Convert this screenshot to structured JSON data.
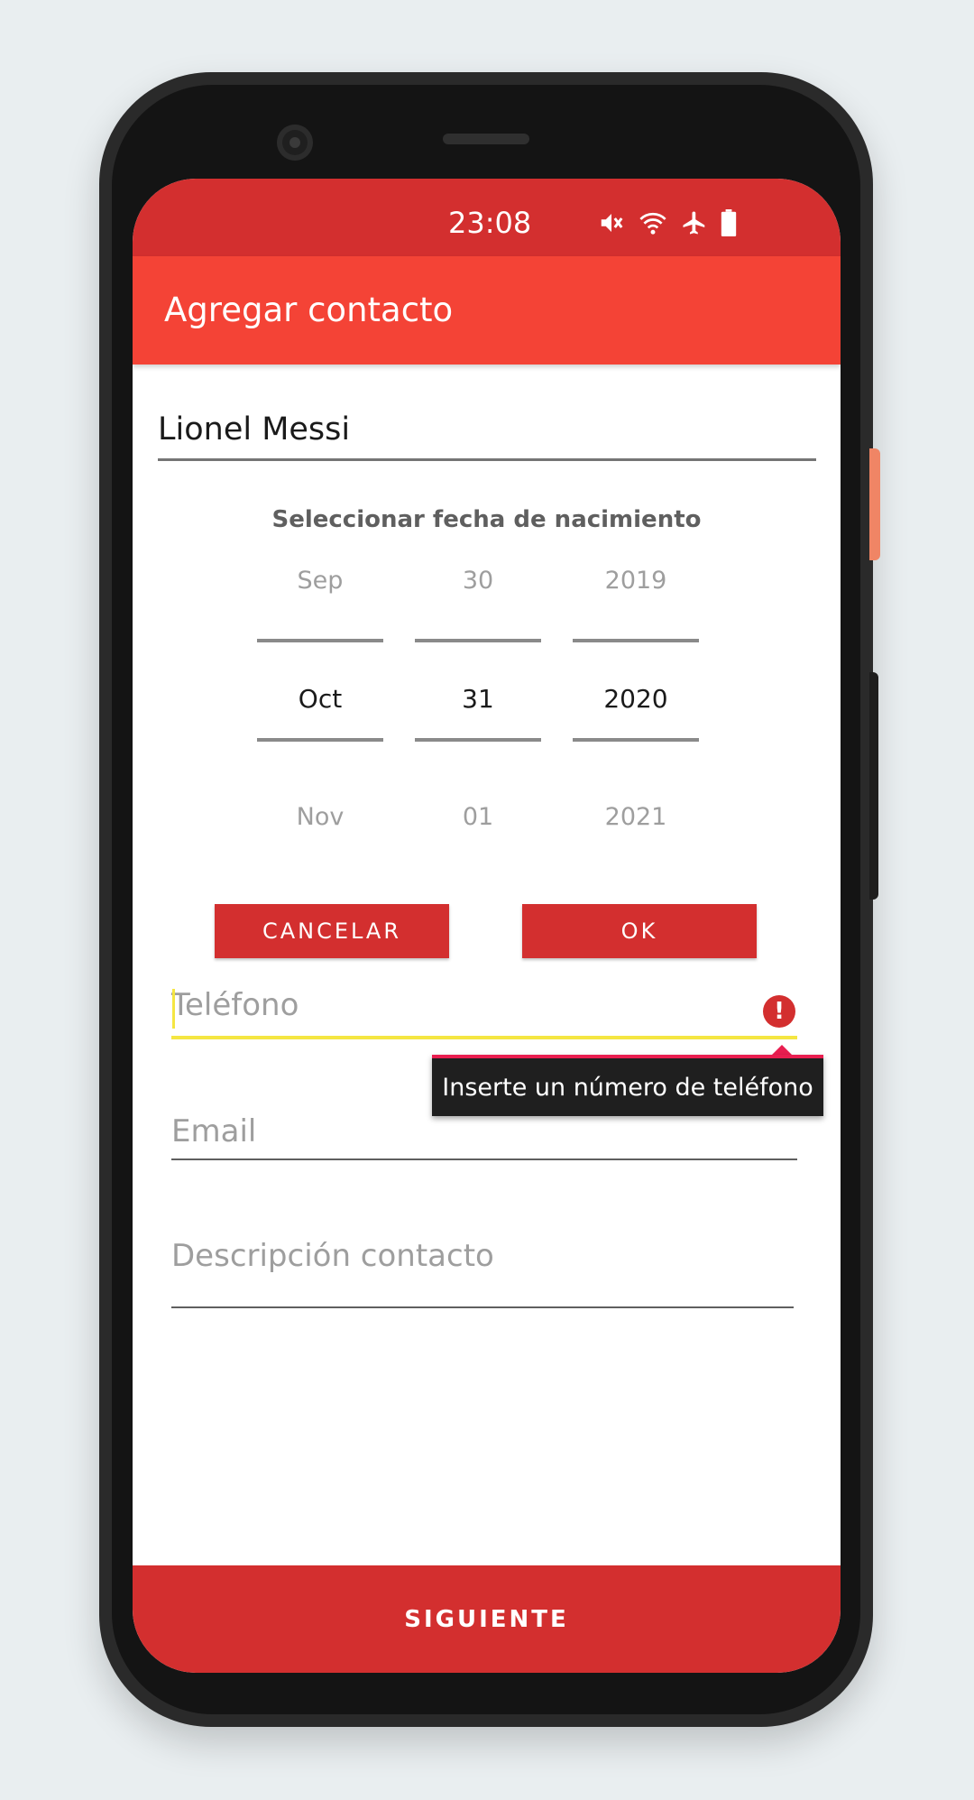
{
  "status_bar": {
    "time": "23:08",
    "icons": [
      "mute-icon",
      "wifi-icon",
      "airplane-icon",
      "battery-icon"
    ]
  },
  "app_bar": {
    "title": "Agregar contacto"
  },
  "form": {
    "name_value": "Lionel Messi",
    "date_picker": {
      "title": "Seleccionar fecha de nacimiento",
      "month": {
        "prev": "Sep",
        "current": "Oct",
        "next": "Nov"
      },
      "day": {
        "prev": "30",
        "current": "31",
        "next": "01"
      },
      "year": {
        "prev": "2019",
        "current": "2020",
        "next": "2021"
      },
      "cancel_label": "CANCELAR",
      "ok_label": "OK"
    },
    "phone_placeholder": "Teléfono",
    "phone_error": "Inserte un número de teléfono",
    "email_placeholder": "Email",
    "description_placeholder": "Descripción contacto"
  },
  "footer": {
    "next_label": "SIGUIENTE"
  },
  "colors": {
    "status_bar": "#d32f2f",
    "app_bar": "#f44336",
    "accent": "#d32f2f",
    "error_highlight": "#f5e642"
  }
}
